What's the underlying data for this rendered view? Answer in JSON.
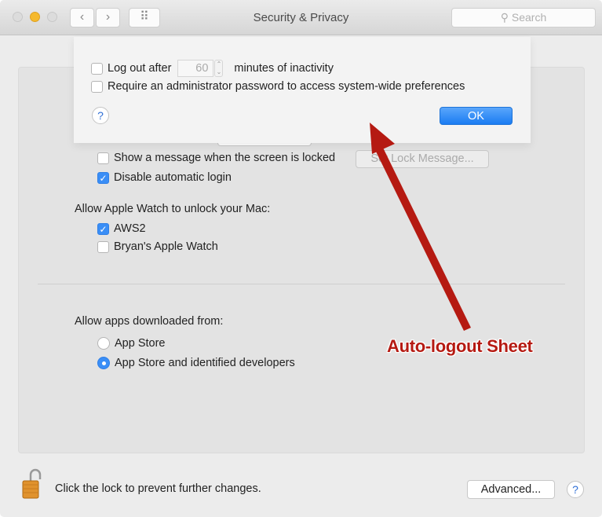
{
  "window": {
    "title": "Security & Privacy",
    "search_placeholder": "Search",
    "nav_back": "‹",
    "nav_forward": "›",
    "grid": "⠿"
  },
  "sheet": {
    "logout_label": "Log out after",
    "logout_minutes": "60",
    "logout_suffix": "minutes of inactivity",
    "logout_checked": false,
    "admin_label": "Require an administrator password to access system-wide preferences",
    "admin_checked": false,
    "help": "?",
    "ok_label": "OK"
  },
  "general": {
    "show_message_label": "Show a message when the screen is locked",
    "show_message_checked": false,
    "set_lock_message_label": "Set Lock Message...",
    "disable_login_label": "Disable automatic login",
    "disable_login_checked": true
  },
  "watch": {
    "heading": "Allow Apple Watch to unlock your Mac:",
    "items": [
      {
        "label": "AWS2",
        "checked": true
      },
      {
        "label": "Bryan's Apple Watch",
        "checked": false
      }
    ]
  },
  "apps": {
    "heading": "Allow apps downloaded from:",
    "options": [
      {
        "label": "App Store",
        "selected": false
      },
      {
        "label": "App Store and identified developers",
        "selected": true
      }
    ]
  },
  "footer": {
    "lock_text": "Click the lock to prevent further changes.",
    "advanced_label": "Advanced...",
    "help": "?"
  },
  "annotation": {
    "label": "Auto-logout Sheet",
    "color": "#b51a12"
  },
  "colors": {
    "accent": "#3a8ef6"
  }
}
